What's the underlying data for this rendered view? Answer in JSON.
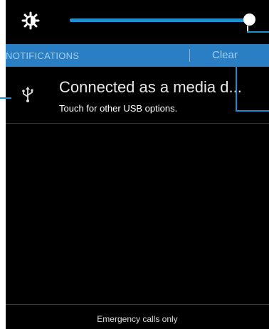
{
  "brightness": {
    "icon": "brightness-icon",
    "level": 1.0
  },
  "notifications": {
    "title": "NOTIFICATIONS",
    "clear_label": "Clear",
    "items": [
      {
        "icon": "usb-icon",
        "heading": "Connected as a media d...",
        "subtext": "Touch for other USB options."
      }
    ]
  },
  "footer": {
    "status": "Emergency calls only"
  },
  "colors": {
    "accent": "#2a7fc4",
    "slider": "#1f8fcf",
    "background": "#000000"
  }
}
